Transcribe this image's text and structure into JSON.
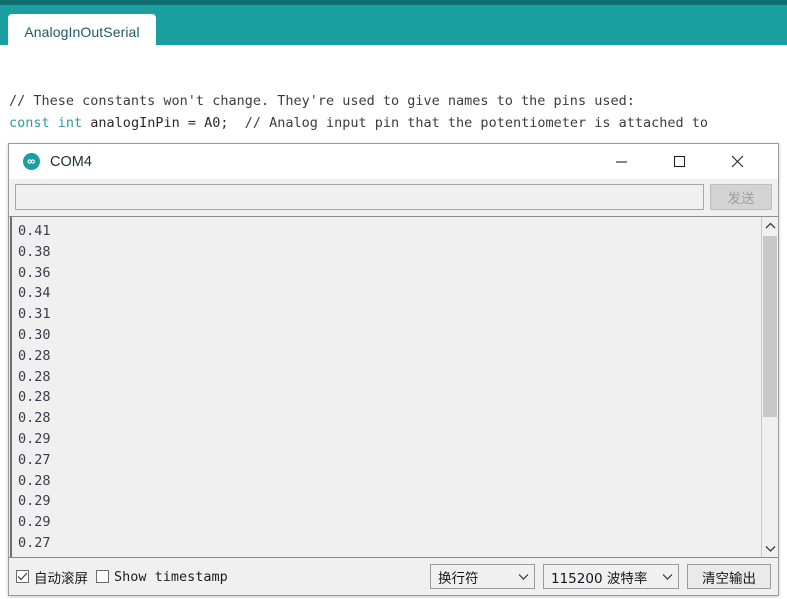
{
  "ide": {
    "tab": {
      "label": "AnalogInOutSerial"
    },
    "code_lines": [
      {
        "segments": [
          {
            "text": "// These constants won't change. They're used to give names to the pins used:",
            "style": "cmt"
          }
        ]
      },
      {
        "segments": [
          {
            "text": "const",
            "style": "kw"
          },
          {
            "text": " ",
            "style": "plain"
          },
          {
            "text": "int",
            "style": "kw"
          },
          {
            "text": " analogInPin = A0;  ",
            "style": "plain"
          },
          {
            "text": "// Analog input pin that the potentiometer is attached to",
            "style": "cmt"
          }
        ]
      }
    ]
  },
  "serial_monitor": {
    "title": "COM4",
    "logo_icon": "arduino-infinity-icon",
    "window_buttons": {
      "minimize": {
        "icon": "minimize-icon",
        "glyph": "—"
      },
      "maximize": {
        "icon": "maximize-icon",
        "glyph": "□"
      },
      "close": {
        "icon": "close-icon",
        "glyph": "✕"
      }
    },
    "send": {
      "input_value": "",
      "input_placeholder": "",
      "button_label": "发送",
      "button_enabled": false
    },
    "output": {
      "lines": [
        "0.41",
        "0.38",
        "0.36",
        "0.34",
        "0.31",
        "0.30",
        "0.28",
        "0.28",
        "0.28",
        "0.28",
        "0.29",
        "0.27",
        "0.28",
        "0.29",
        "0.29",
        "0.27"
      ]
    },
    "scrollbar": {
      "up_icon": "chevron-up-icon",
      "down_icon": "chevron-down-icon"
    },
    "footer": {
      "autoscroll": {
        "label": "自动滚屏",
        "checked": true
      },
      "show_timestamp": {
        "label": "Show timestamp",
        "checked": false
      },
      "line_ending": {
        "value": "换行符",
        "arrow_icon": "chevron-down-icon"
      },
      "baud_rate": {
        "value": "115200 波特率",
        "arrow_icon": "chevron-down-icon"
      },
      "clear_output": {
        "label": "清空输出"
      }
    }
  },
  "colors": {
    "teal": "#1a9fa0",
    "teal_dark": "#0f6e70",
    "keyword": "#2d9ca3",
    "output_text": "#3b3b50"
  }
}
